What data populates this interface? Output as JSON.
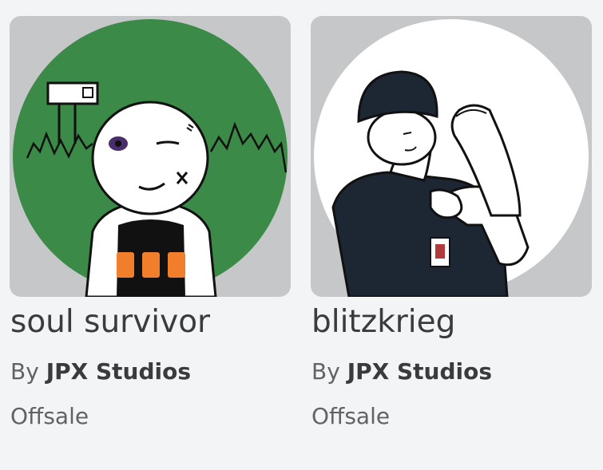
{
  "items": [
    {
      "name": "soul survivor",
      "by_label": "By",
      "creator": "JPX Studios",
      "price": "Offsale",
      "thumbnail_icon": "soul-survivor-avatar-icon"
    },
    {
      "name": "blitzkrieg",
      "by_label": "By",
      "creator": "JPX Studios",
      "price": "Offsale",
      "thumbnail_icon": "blitzkrieg-avatar-icon"
    }
  ],
  "colors": {
    "page_background": "#f2f4f5",
    "thumb_background": "#c6c7c9",
    "item1_circle": "#3b8a48",
    "item2_circle": "#ffffff",
    "title_text": "#393b3d",
    "secondary_text": "#606264"
  }
}
